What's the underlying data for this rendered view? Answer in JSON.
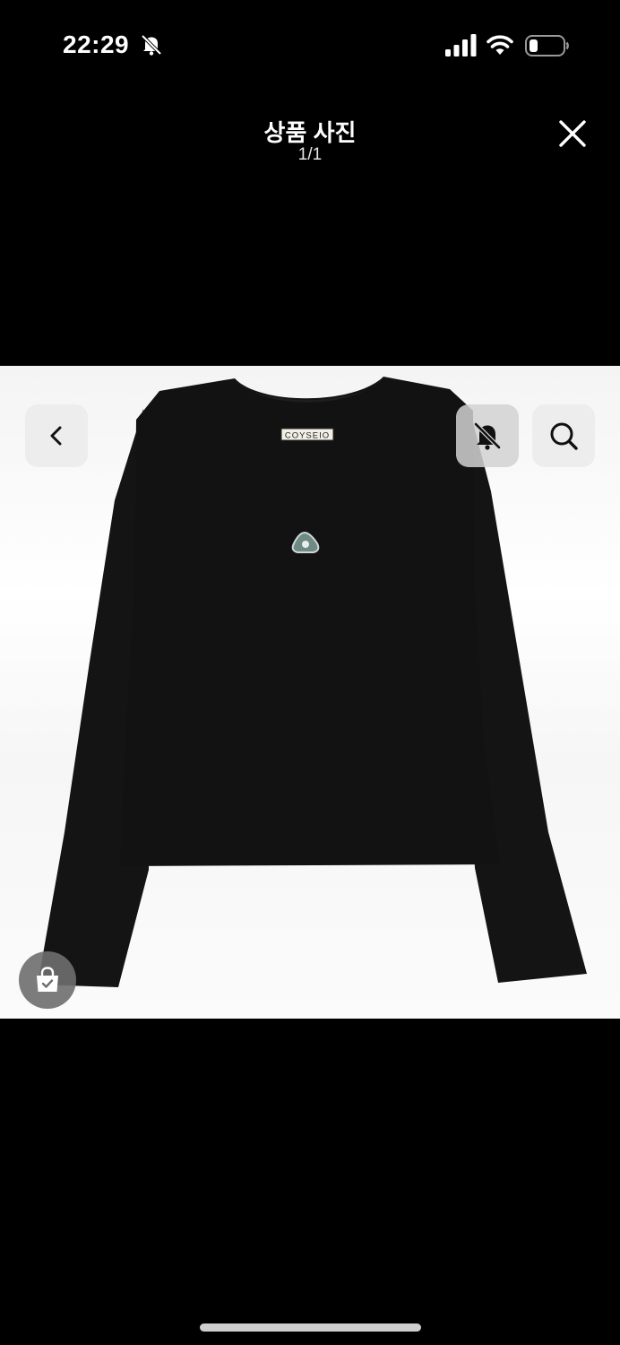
{
  "status_bar": {
    "time": "22:29",
    "icons": [
      "bell-slash-icon",
      "cellular-signal-icon",
      "wifi-icon",
      "battery-icon"
    ]
  },
  "viewer": {
    "title": "상품 사진",
    "counter": "1/1",
    "close_icon": "close-icon"
  },
  "product_image": {
    "label_text": "COYSEIO",
    "colors": {
      "garment": "#121212",
      "background": "#ffffff"
    }
  },
  "overlay_buttons": {
    "back_icon": "chevron-left-icon",
    "alarm_icon": "bell-slash-icon",
    "search_icon": "search-icon",
    "cart_icon": "shopping-bag-check-icon"
  }
}
